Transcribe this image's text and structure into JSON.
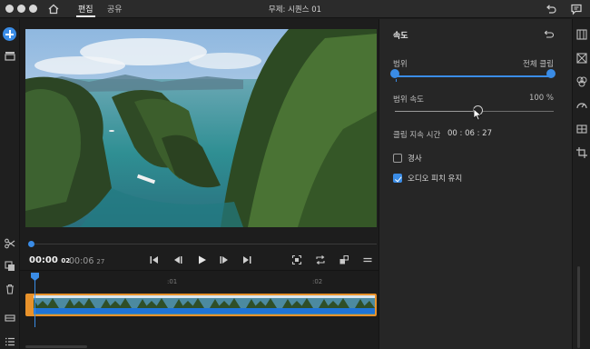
{
  "app": {
    "project_title": "무제: 시퀀스 01"
  },
  "tabs": [
    {
      "label": "편집",
      "active": true
    },
    {
      "label": "공유",
      "active": false
    }
  ],
  "icons": {
    "home": "home-icon",
    "undo": "undo-icon",
    "chat": "chat-icon",
    "add": "add-icon",
    "media": "media-icon",
    "scissors": "scissors-icon",
    "duplicate": "duplicate-icon",
    "trash": "trash-icon",
    "track": "track-icon",
    "list": "list-icon",
    "rr1": "adjust-icon",
    "rr2": "transition-icon",
    "rr3": "color-icon",
    "rr4": "speed-icon",
    "rr5": "audio-icon",
    "rr6": "crop-icon"
  },
  "transport": {
    "current_time": "00:00",
    "current_frames": "02",
    "total_time": "00:06",
    "total_frames": "27",
    "ruler_marks": [
      ":01",
      ":02"
    ]
  },
  "inspector": {
    "title": "속도",
    "range_label": "범위",
    "range_value": "전체 클립",
    "speed_label": "범위 속도",
    "speed_value": "100 %",
    "speed_level": 0.52,
    "duration_label": "클립 지속 시간",
    "duration_value": "00 : 06 : 27",
    "ramp_label": "경사",
    "ramp_checked": false,
    "pitch_label": "오디오 피치 유지",
    "pitch_checked": true
  },
  "colors": {
    "accent": "#3a8ce6",
    "clip_border": "#e8922b",
    "panel_bg": "#262626",
    "app_bg": "#1d1d1d"
  }
}
